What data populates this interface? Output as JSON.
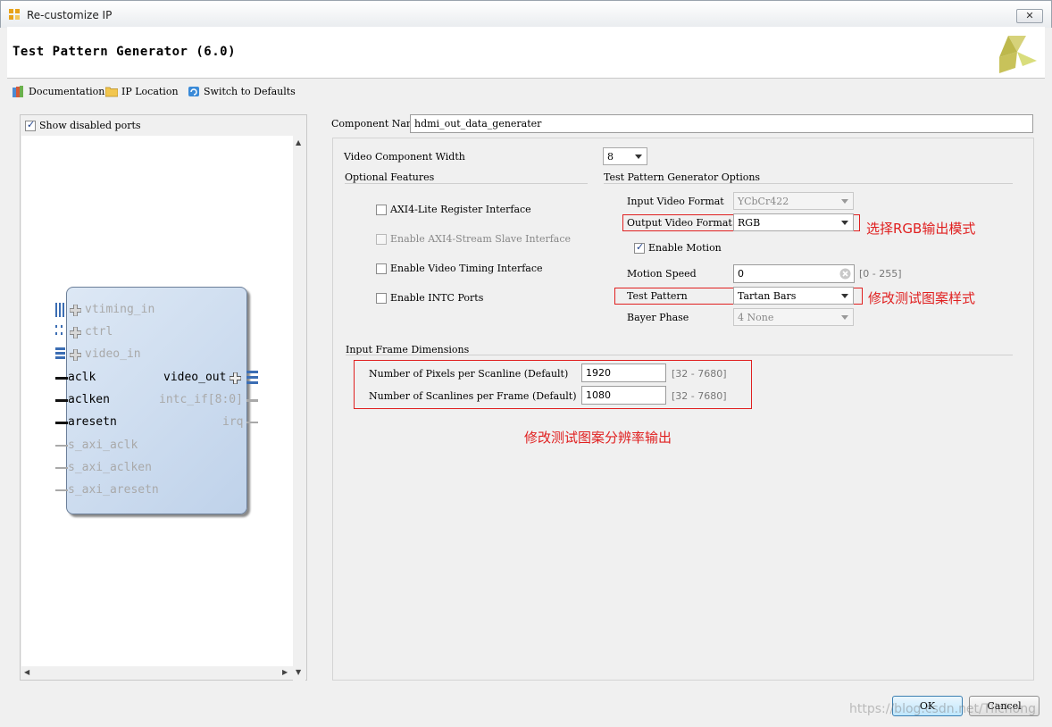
{
  "window": {
    "title": "Re-customize IP",
    "close_label": "✕"
  },
  "header": {
    "ip_title": "Test Pattern Generator (6.0)"
  },
  "toolbar": {
    "documentation": "Documentation",
    "ip_location": "IP Location",
    "switch_defaults": "Switch to Defaults"
  },
  "left": {
    "show_disabled_ports": "Show disabled ports",
    "ports_left": [
      "vtiming_in",
      "ctrl",
      "video_in",
      "aclk",
      "aclken",
      "aresetn",
      "s_axi_aclk",
      "s_axi_aclken",
      "s_axi_aresetn"
    ],
    "ports_right": [
      "video_out",
      "intc_if[8:0]",
      "irq"
    ]
  },
  "form": {
    "component_name_label": "Component Name",
    "component_name_value": "hdmi_out_data_generater",
    "video_width_label": "Video Component Width",
    "video_width_value": "8",
    "optional_features": "Optional Features",
    "tpg_options": "Test Pattern Generator Options",
    "axi4_lite": "AXI4-Lite Register Interface",
    "axi4_stream_slave": "Enable AXI4-Stream Slave Interface",
    "video_timing": "Enable Video Timing Interface",
    "intc_ports": "Enable INTC Ports",
    "input_video_format_label": "Input Video Format",
    "input_video_format_value": "YCbCr422",
    "output_video_format_label": "Output Video Format",
    "output_video_format_value": "RGB",
    "enable_motion": "Enable Motion",
    "motion_speed_label": "Motion Speed",
    "motion_speed_value": "0",
    "motion_speed_range": "[0 - 255]",
    "test_pattern_label": "Test Pattern",
    "test_pattern_value": "Tartan Bars",
    "bayer_phase_label": "Bayer Phase",
    "bayer_phase_value": "4 None",
    "input_frame_dims": "Input Frame Dimensions",
    "pixels_label": "Number of Pixels per Scanline (Default)",
    "pixels_value": "1920",
    "pixels_range": "[32 - 7680]",
    "lines_label": "Number of Scanlines per Frame (Default)",
    "lines_value": "1080",
    "lines_range": "[32 - 7680]"
  },
  "annotations": {
    "note_rgb": "选择RGB输出模式",
    "note_pattern": "修改测试图案样式",
    "note_resolution": "修改测试图案分辨率输出"
  },
  "buttons": {
    "ok": "OK",
    "cancel": "Cancel"
  },
  "watermark": "https://blog.csdn.net/Tlichong",
  "colors": {
    "annotation_red": "#e02020",
    "block_fill": "#c9daef"
  }
}
